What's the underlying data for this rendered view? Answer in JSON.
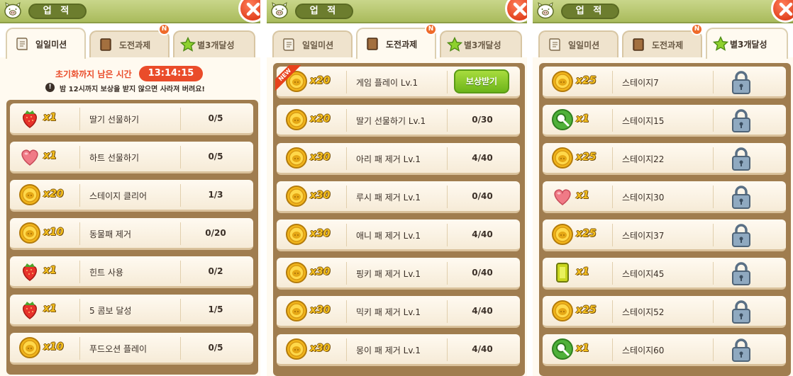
{
  "panels": [
    {
      "title": "업 적",
      "tabs": [
        {
          "label": "일일미션"
        },
        {
          "label": "도전과제",
          "badge": "N"
        },
        {
          "label": "별3개달성"
        }
      ],
      "active_tab": 0,
      "timer": {
        "label": "초기화까지 남은 시간",
        "value": "13:14:15"
      },
      "notice": {
        "icon": "!",
        "text": "밤 12시까지 보상을 받지 않으면 사라져 버려요!"
      },
      "rows": [
        {
          "icon": "strawberry-icon",
          "qty": "x1",
          "name": "딸기 선물하기",
          "progress": "0/5"
        },
        {
          "icon": "heart-icon",
          "qty": "x1",
          "name": "하트 선물하기",
          "progress": "0/5"
        },
        {
          "icon": "coin-icon",
          "qty": "x20",
          "name": "스테이지 클리어",
          "progress": "1/3"
        },
        {
          "icon": "coin-icon",
          "qty": "x10",
          "name": "동물패 제거",
          "progress": "0/20"
        },
        {
          "icon": "strawberry-icon",
          "qty": "x1",
          "name": "힌트 사용",
          "progress": "0/2"
        },
        {
          "icon": "strawberry-icon",
          "qty": "x1",
          "name": "5 콤보 달성",
          "progress": "1/5"
        },
        {
          "icon": "coin-icon",
          "qty": "x10",
          "name": "푸드오션 플레이",
          "progress": "0/5"
        }
      ]
    },
    {
      "title": "업 적",
      "tabs": [
        {
          "label": "일일미션"
        },
        {
          "label": "도전과제",
          "badge": "N"
        },
        {
          "label": "별3개달성"
        }
      ],
      "active_tab": 1,
      "rows": [
        {
          "icon": "coin-icon",
          "qty": "x20",
          "name": "게임 플레이 Lv.1",
          "action": "보상받기",
          "new": "NEW"
        },
        {
          "icon": "coin-icon",
          "qty": "x20",
          "name": "딸기 선물하기 Lv.1",
          "progress": "0/30"
        },
        {
          "icon": "coin-icon",
          "qty": "x30",
          "name": "아리 패 제거 Lv.1",
          "progress": "4/40"
        },
        {
          "icon": "coin-icon",
          "qty": "x30",
          "name": "루시 패 제거 Lv.1",
          "progress": "0/40"
        },
        {
          "icon": "coin-icon",
          "qty": "x30",
          "name": "애니 패 제거 Lv.1",
          "progress": "4/40"
        },
        {
          "icon": "coin-icon",
          "qty": "x30",
          "name": "핑키 패 제거 Lv.1",
          "progress": "0/40"
        },
        {
          "icon": "coin-icon",
          "qty": "x30",
          "name": "믹키 패 제거 Lv.1",
          "progress": "4/40"
        },
        {
          "icon": "coin-icon",
          "qty": "x30",
          "name": "몽이 패 제거 Lv.1",
          "progress": "4/40"
        }
      ]
    },
    {
      "title": "업 적",
      "tabs": [
        {
          "label": "일일미션"
        },
        {
          "label": "도전과제",
          "badge": "N"
        },
        {
          "label": "별3개달성"
        }
      ],
      "active_tab": 2,
      "rows": [
        {
          "icon": "coin-icon",
          "qty": "x25",
          "name": "스테이지7",
          "locked": true
        },
        {
          "icon": "magnifier-icon",
          "qty": "x1",
          "name": "스테이지15",
          "locked": true
        },
        {
          "icon": "coin-icon",
          "qty": "x25",
          "name": "스테이지22",
          "locked": true
        },
        {
          "icon": "heart-icon",
          "qty": "x1",
          "name": "스테이지30",
          "locked": true
        },
        {
          "icon": "coin-icon",
          "qty": "x25",
          "name": "스테이지37",
          "locked": true
        },
        {
          "icon": "gem-icon",
          "qty": "x1",
          "name": "스테이지45",
          "locked": true
        },
        {
          "icon": "coin-icon",
          "qty": "x25",
          "name": "스테이지52",
          "locked": true
        },
        {
          "icon": "magnifier-icon",
          "qty": "x1",
          "name": "스테이지60",
          "locked": true
        }
      ]
    }
  ],
  "colors": {
    "header": "#a9bb5c",
    "accent_red": "#ea4c2a",
    "frame": "#a07d4f",
    "row_bg": "#fffaf1",
    "claim_green": "#6db51a",
    "qty_gold": "#f6c01e"
  }
}
